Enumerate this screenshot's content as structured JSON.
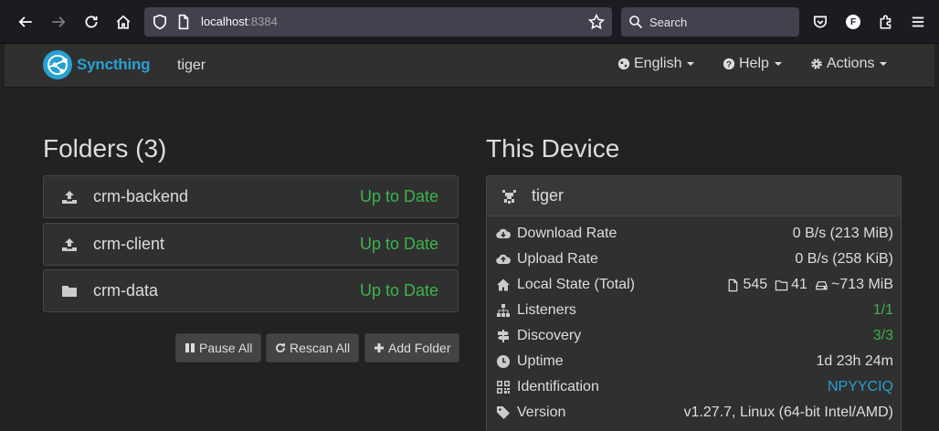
{
  "browser": {
    "url_host": "localhost",
    "url_port": ":8384",
    "search_placeholder": "Search",
    "account_initial": "F"
  },
  "navbar": {
    "brand": "Syncthing",
    "device_name": "tiger",
    "language": "English",
    "help": "Help",
    "actions": "Actions"
  },
  "folders": {
    "heading": "Folders (3)",
    "items": [
      {
        "name": "crm-backend",
        "status": "Up to Date",
        "icon": "upload-icon"
      },
      {
        "name": "crm-client",
        "status": "Up to Date",
        "icon": "upload-icon"
      },
      {
        "name": "crm-data",
        "status": "Up to Date",
        "icon": "folder-icon"
      }
    ],
    "buttons": {
      "pause_all": "Pause All",
      "rescan_all": "Rescan All",
      "add_folder": "Add Folder"
    }
  },
  "this_device": {
    "heading": "This Device",
    "name": "tiger",
    "rows": {
      "download_rate": {
        "label": "Download Rate",
        "value": "0 B/s (213 MiB)"
      },
      "upload_rate": {
        "label": "Upload Rate",
        "value": "0 B/s (258 KiB)"
      },
      "local_state": {
        "label": "Local State (Total)",
        "files": "545",
        "dirs": "41",
        "size": "~713 MiB"
      },
      "listeners": {
        "label": "Listeners",
        "value": "1/1"
      },
      "discovery": {
        "label": "Discovery",
        "value": "3/3"
      },
      "uptime": {
        "label": "Uptime",
        "value": "1d 23h 24m"
      },
      "identification": {
        "label": "Identification",
        "value": "NPYYCIQ"
      },
      "version": {
        "label": "Version",
        "value": "v1.27.7, Linux (64-bit Intel/AMD)"
      }
    }
  },
  "colors": {
    "accent": "#27a1d3",
    "success": "#3cb44b",
    "panel": "#303030",
    "background": "#222222"
  }
}
